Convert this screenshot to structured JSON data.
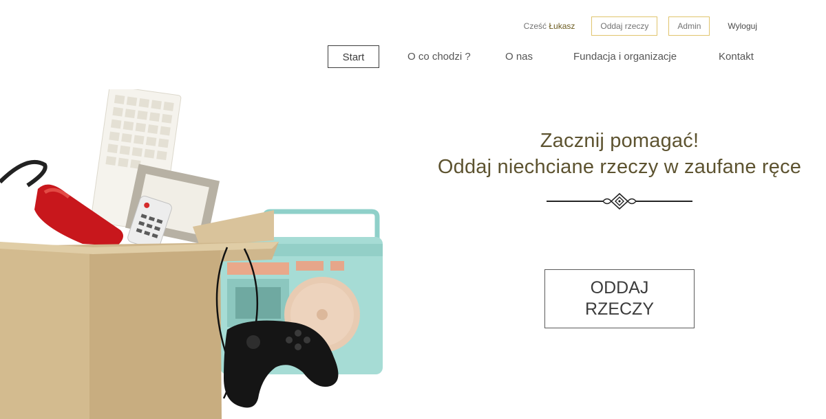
{
  "user_bar": {
    "greeting_prefix": "Cześć ",
    "user_name": "Łukasz",
    "give_button": "Oddaj rzeczy",
    "admin_button": "Admin",
    "logout": "Wyloguj"
  },
  "nav": {
    "items": [
      {
        "label": "Start",
        "active": true
      },
      {
        "label": "O co chodzi ?"
      },
      {
        "label": "O nas"
      },
      {
        "label": "Fundacja i organizacje"
      },
      {
        "label": "Kontakt"
      }
    ]
  },
  "hero": {
    "line1": "Zacznij pomagać!",
    "line2": "Oddaj niechciane rzeczy w zaufane ręce",
    "cta_line1": "ODDAJ",
    "cta_line2": "RZECZY"
  },
  "colors": {
    "accent_gold": "#e0c46c",
    "heading": "#5d5330",
    "text": "#555555"
  }
}
